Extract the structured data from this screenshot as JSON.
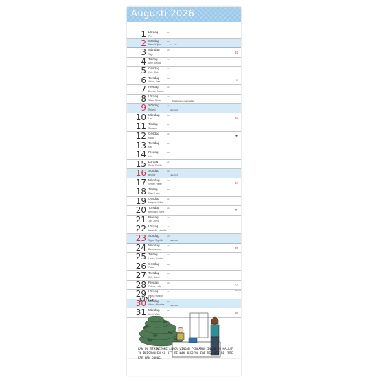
{
  "calendar": {
    "month_title": "Augusti 2026",
    "days": [
      {
        "num": "1",
        "weekday": "Lördag",
        "names": "Per",
        "seq": "213",
        "sunday": false
      },
      {
        "num": "2",
        "weekday": "Söndag",
        "names": "Karlo, Kajsa",
        "tag": "9 e. tref.",
        "seq": "214",
        "sunday": true
      },
      {
        "num": "3",
        "weekday": "Måndag",
        "names": "Tage",
        "seq": "215",
        "week": "32",
        "sunday": false
      },
      {
        "num": "4",
        "weekday": "Tisdag",
        "names": "Arne, Arnold",
        "seq": "216",
        "sunday": false
      },
      {
        "num": "5",
        "weekday": "Onsdag",
        "names": "Ulrik, Alrik",
        "seq": "217",
        "sunday": false
      },
      {
        "num": "6",
        "weekday": "Torsdag",
        "names": "Alfons, Inez",
        "seq": "218",
        "moon": "◑",
        "sunday": false
      },
      {
        "num": "7",
        "weekday": "Fredag",
        "names": "Dennis, Denise",
        "seq": "219",
        "sunday": false
      },
      {
        "num": "8",
        "weekday": "Lördag",
        "names": "Silvia, Sylvia",
        "tag": "Kristinegens namnsdag",
        "seq": "220",
        "sunday": false
      },
      {
        "num": "9",
        "weekday": "Söndag",
        "names": "Roland",
        "tag": "10 e. tref.",
        "seq": "221",
        "sunday": true
      },
      {
        "num": "10",
        "weekday": "Måndag",
        "names": "Lars",
        "seq": "222",
        "week": "33",
        "sunday": false
      },
      {
        "num": "11",
        "weekday": "Tisdag",
        "names": "Susanna",
        "seq": "223",
        "sunday": false
      },
      {
        "num": "12",
        "weekday": "Onsdag",
        "names": "Klara",
        "seq": "224",
        "moon": "●",
        "sunday": false
      },
      {
        "num": "13",
        "weekday": "Torsdag",
        "names": "Kaj",
        "seq": "225",
        "sunday": false
      },
      {
        "num": "14",
        "weekday": "Fredag",
        "names": "Uno",
        "seq": "226",
        "sunday": false
      },
      {
        "num": "15",
        "weekday": "Lördag",
        "names": "Stella, Estelle",
        "seq": "227",
        "sunday": false
      },
      {
        "num": "16",
        "weekday": "Söndag",
        "names": "Brynolf",
        "tag": "11 e. tref.",
        "seq": "228",
        "sunday": true
      },
      {
        "num": "17",
        "weekday": "Måndag",
        "names": "Verner, Valter",
        "seq": "229",
        "week": "34",
        "sunday": false
      },
      {
        "num": "18",
        "weekday": "Tisdag",
        "names": "Ellen, Lena",
        "seq": "230",
        "sunday": false
      },
      {
        "num": "19",
        "weekday": "Onsdag",
        "names": "Magnus, Måns",
        "seq": "231",
        "sunday": false
      },
      {
        "num": "20",
        "weekday": "Torsdag",
        "names": "Bernhard, Bernt",
        "seq": "232",
        "moon": "◐",
        "sunday": false
      },
      {
        "num": "21",
        "weekday": "Fredag",
        "names": "Jon, Jonna",
        "seq": "233",
        "sunday": false
      },
      {
        "num": "22",
        "weekday": "Lördag",
        "names": "Henrietta, Henrika",
        "seq": "234",
        "sunday": false
      },
      {
        "num": "23",
        "weekday": "Söndag",
        "names": "Signe, Signhild",
        "tag": "12 e. tref.",
        "seq": "235",
        "sunday": true
      },
      {
        "num": "24",
        "weekday": "Måndag",
        "names": "Bartolomeus",
        "seq": "236",
        "week": "35",
        "sunday": false
      },
      {
        "num": "25",
        "weekday": "Tisdag",
        "names": "Lovisa, Louise",
        "seq": "237",
        "sunday": false
      },
      {
        "num": "26",
        "weekday": "Onsdag",
        "names": "Östen",
        "seq": "238",
        "sunday": false
      },
      {
        "num": "27",
        "weekday": "Torsdag",
        "names": "Rolf, Raoul",
        "seq": "239",
        "sunday": false
      },
      {
        "num": "28",
        "weekday": "Fredag",
        "names": "Fatima, Leila",
        "seq": "240",
        "moon": "○",
        "sunday": false
      },
      {
        "num": "29",
        "weekday": "Lördag",
        "names": "Hans, Hampus",
        "seq": "241",
        "sunday": false
      },
      {
        "num": "30",
        "weekday": "Söndag",
        "names": "Albert, Albertina",
        "tag": "13 e. tref.",
        "seq": "242",
        "sunday": true
      },
      {
        "num": "31",
        "weekday": "Måndag",
        "names": "Arvid, Vidar",
        "seq": "243",
        "week": "36",
        "sunday": false
      }
    ],
    "footer_note": "Svanik",
    "cartoon_signature": "KING",
    "cartoon_caption": "KAN DU ÅTMINSTONE LÅNGA VINDAN PENGARNA INNAN DU KALLAR IN PERSONALEN SÅ ATT DE KAN BEGRIPA FÖR DEN ATT DE INTE FÅR NÅN BONUS."
  }
}
